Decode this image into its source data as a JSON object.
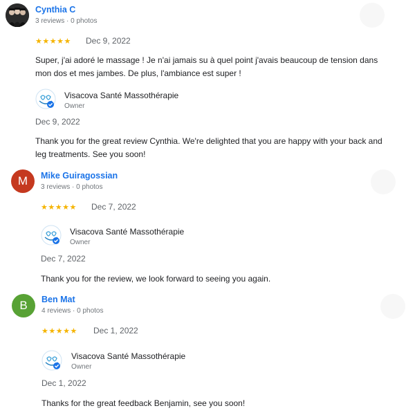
{
  "reviews": [
    {
      "reviewer": "Cynthia C",
      "meta": "3 reviews · 0 photos",
      "avatar_letter": "",
      "stars": "★★★★★",
      "date": "Dec 9, 2022",
      "text": "Super, j'ai adoré le massage ! Je n'ai jamais su à quel point j'avais beaucoup de tension dans mon dos et mes jambes. De plus, l'ambiance est super !",
      "response": {
        "business": "Visacova Santé Massothérapie",
        "role": "Owner",
        "date": "Dec 9, 2022",
        "text": "Thank you for the great review Cynthia. We're delighted that you are happy with your back and leg treatments. See you soon!"
      }
    },
    {
      "reviewer": "Mike Guiragossian",
      "meta": "3 reviews · 0 photos",
      "avatar_letter": "M",
      "stars": "★★★★★",
      "date": "Dec 7, 2022",
      "text": "",
      "response": {
        "business": "Visacova Santé Massothérapie",
        "role": "Owner",
        "date": "Dec 7, 2022",
        "text": "Thank you for the review, we look forward to seeing you again."
      }
    },
    {
      "reviewer": "Ben Mat",
      "meta": "4 reviews · 0 photos",
      "avatar_letter": "B",
      "stars": "★★★★★",
      "date": "Dec 1, 2022",
      "text": "",
      "response": {
        "business": "Visacova Santé Massothérapie",
        "role": "Owner",
        "date": "Dec 1, 2022",
        "text": "Thanks for the great feedback Benjamin, see you soon!"
      }
    }
  ],
  "rating": {
    "value": 5,
    "max": 5
  },
  "colors": {
    "link": "#1a73e8",
    "star": "#f5b400",
    "avatar_m": "#c5391f",
    "avatar_b": "#58a235"
  }
}
